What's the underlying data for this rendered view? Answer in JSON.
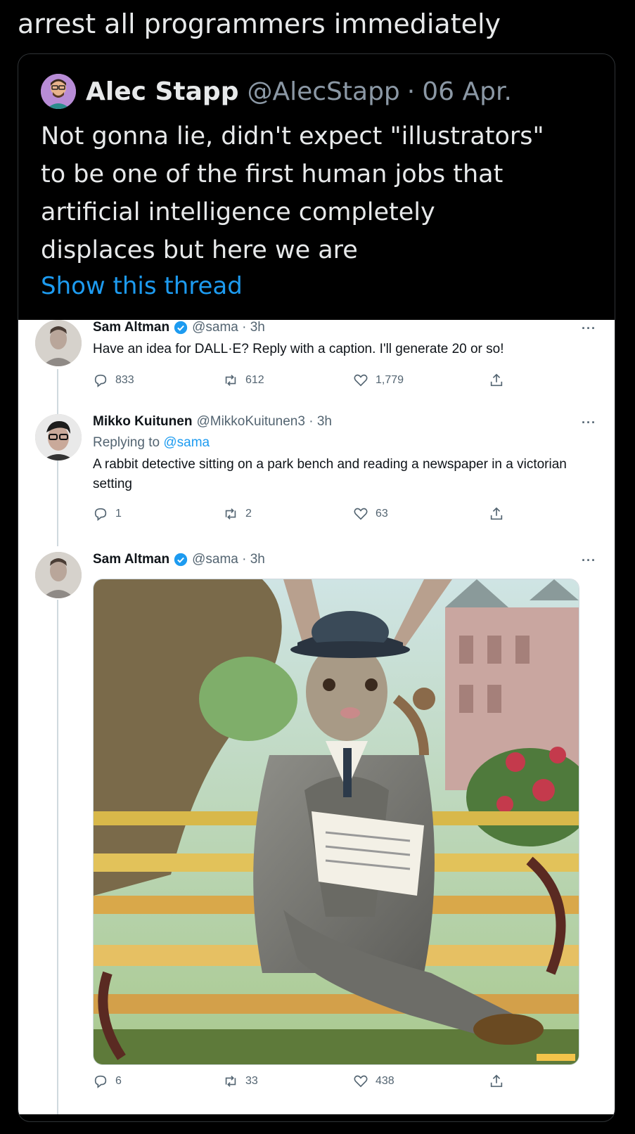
{
  "post_text": "arrest all programmers immediately",
  "quoted_tweet": {
    "author_name": "Alec Stapp",
    "author_handle": "@AlecStapp",
    "separator": "·",
    "date": "06 Apr.",
    "body_lines": [
      "Not gonna lie, didn't expect \"illustrators\"",
      "to be one of the first human jobs that",
      "artificial intelligence completely",
      "displaces but here we are"
    ],
    "show_thread": "Show this thread"
  },
  "screenshot": {
    "tweets": [
      {
        "name": "Sam Altman",
        "meta": "@sama · 3h",
        "text": "Have an idea for DALL·E? Reply with a caption. I'll generate 20 or so!",
        "replies": "833",
        "retweets": "612",
        "likes": "1,779"
      },
      {
        "name": "Mikko Kuitunen",
        "meta": "@MikkoKuitunen3 · 3h",
        "replying_label": "Replying to",
        "replying_handle": "@sama",
        "text": "A rabbit detective sitting on a park bench and reading a newspaper in a victorian setting",
        "replies": "1",
        "retweets": "2",
        "likes": "63"
      },
      {
        "name": "Sam Altman",
        "meta": "@sama · 3h",
        "replies": "6",
        "retweets": "33",
        "likes": "438"
      }
    ],
    "more_label": "···"
  },
  "colors": {
    "accent": "#1d9bf0",
    "background_dark": "#000000",
    "text_light": "#e7e9ea",
    "muted": "#8b98a5"
  }
}
